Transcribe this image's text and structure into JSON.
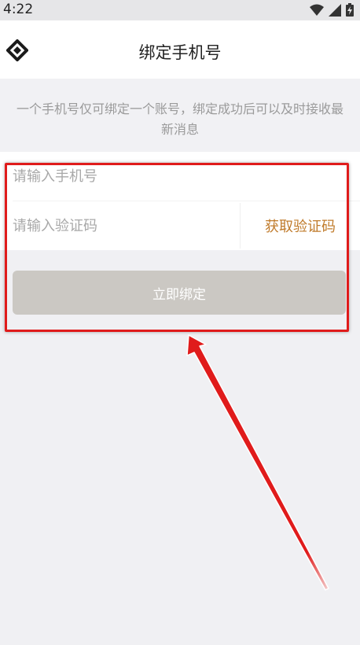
{
  "status_bar": {
    "time": "4:22"
  },
  "header": {
    "title": "绑定手机号",
    "back_icon": "diamond-back-icon"
  },
  "notice": {
    "text": "一个手机号仅可绑定一个账号，绑定成功后可以及时接收最新消息"
  },
  "form": {
    "phone_placeholder": "请输入手机号",
    "code_placeholder": "请输入验证码",
    "get_code_label": "获取验证码"
  },
  "bind_button": {
    "label": "立即绑定"
  },
  "colors": {
    "accent": "#c07b2b",
    "button_disabled": "#cbc8c3",
    "annotation_red": "#e01b1b",
    "background": "#f0f0f3"
  }
}
